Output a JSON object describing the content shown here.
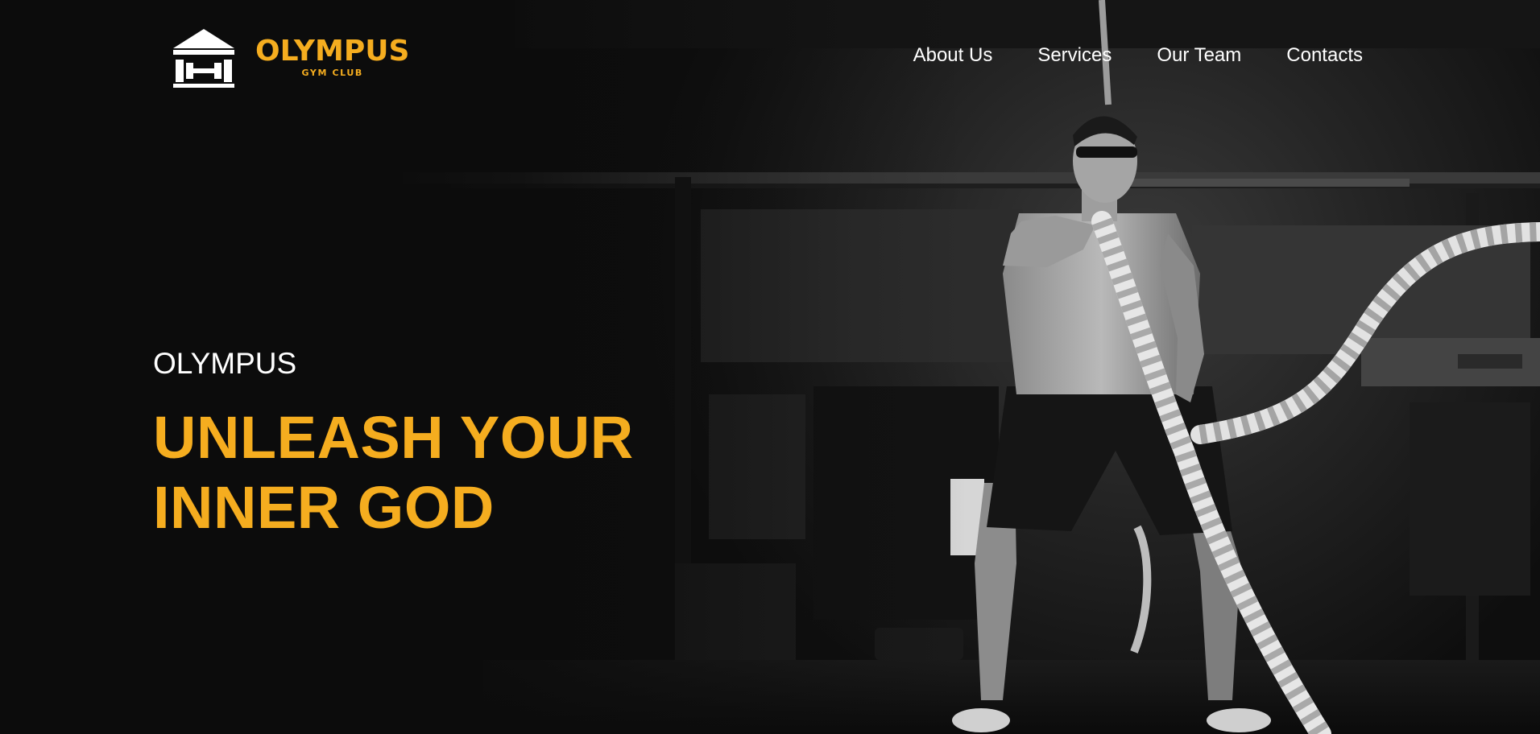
{
  "brand": {
    "name": "OLYMPUS",
    "tagline": "GYM CLUB",
    "logo_icon": "temple-barbell-icon",
    "accent_color": "#f5ad1f"
  },
  "nav": {
    "items": [
      {
        "label": "About Us"
      },
      {
        "label": "Services"
      },
      {
        "label": "Our Team"
      },
      {
        "label": "Contacts"
      }
    ]
  },
  "hero": {
    "eyebrow": "OLYMPUS",
    "heading_line1": "UNLEASH YOUR",
    "heading_line2": "INNER GOD",
    "background": "black-and-white-battle-rope-athlete-photo"
  },
  "colors": {
    "background": "#0c0c0c",
    "text": "#ffffff",
    "accent": "#f5ad1f"
  }
}
